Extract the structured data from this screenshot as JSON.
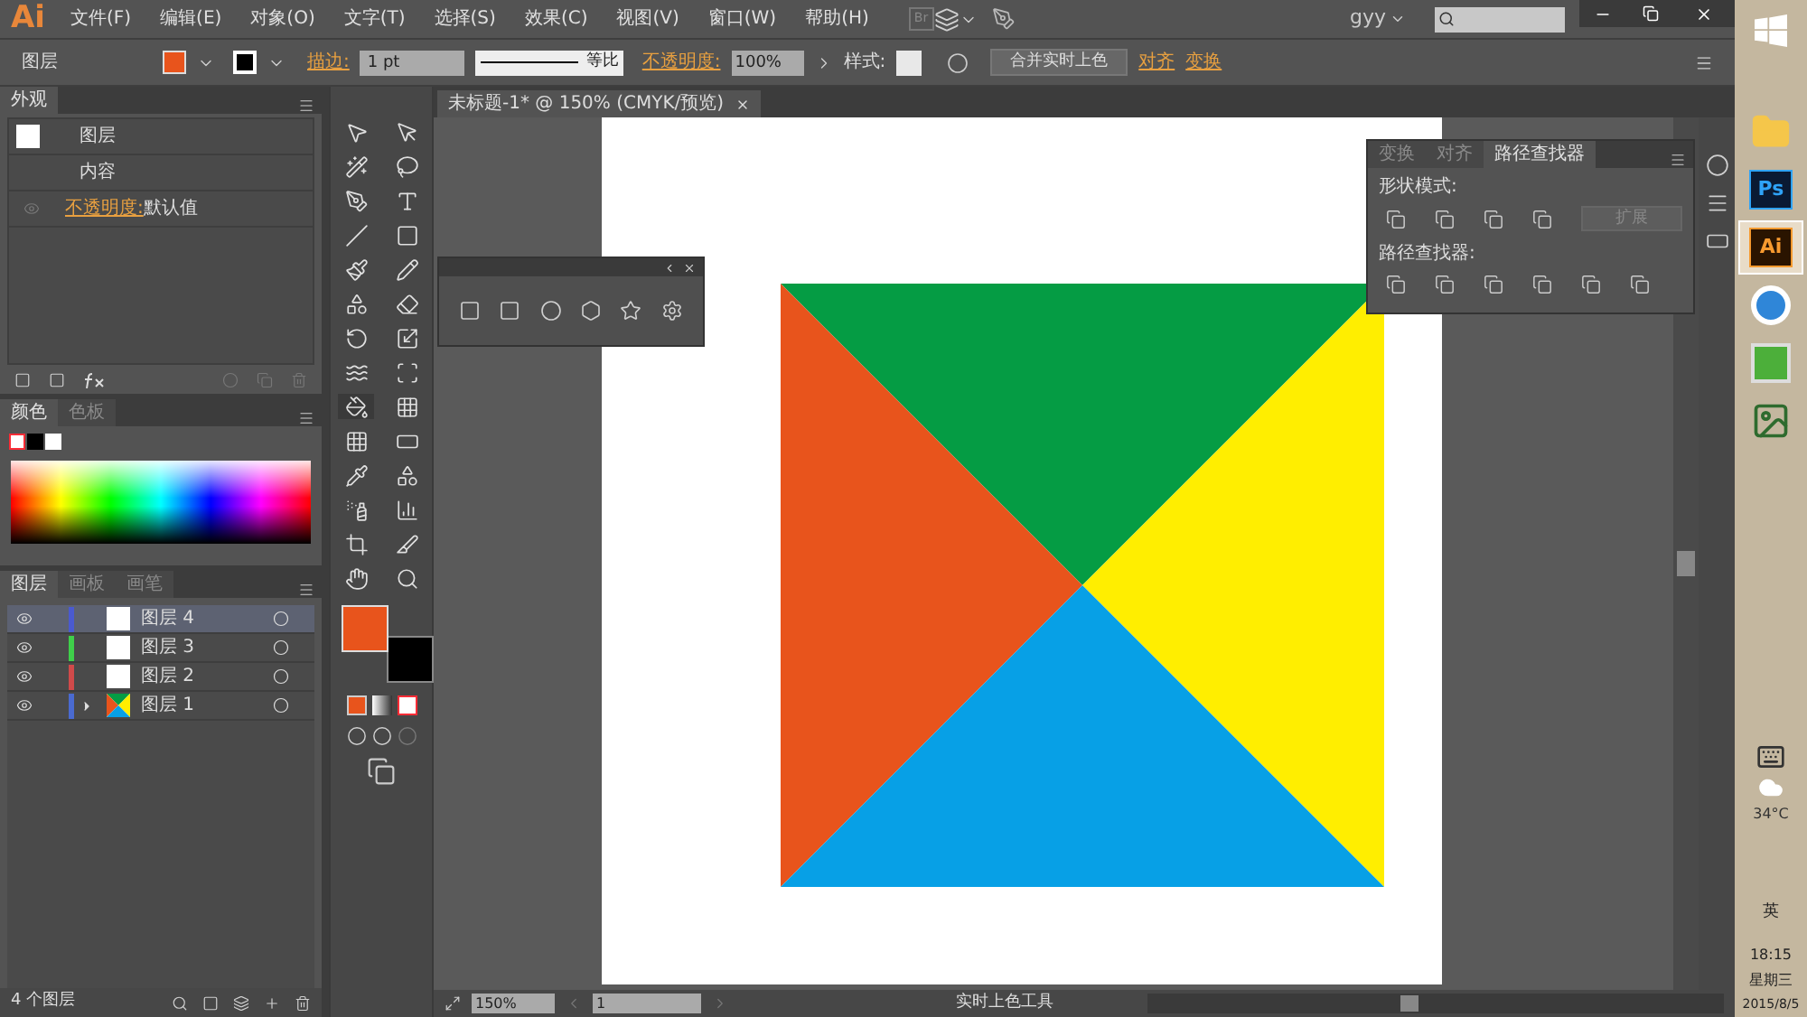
{
  "app": {
    "logo": "Ai",
    "menu": [
      "文件(F)",
      "编辑(E)",
      "对象(O)",
      "文字(T)",
      "选择(S)",
      "效果(C)",
      "视图(V)",
      "窗口(W)",
      "帮助(H)"
    ],
    "bridge": "Br",
    "user": "gyy"
  },
  "control_bar": {
    "selection": "图层",
    "stroke_label": "描边:",
    "stroke_weight": "1 pt",
    "profile": "等比",
    "opacity_label": "不透明度:",
    "opacity": "100%",
    "style_label": "样式:",
    "merge_button": "合并实时上色",
    "align_link": "对齐",
    "transform_link": "变换"
  },
  "appearance_panel": {
    "tab": "外观",
    "title_row": "图层",
    "content_row": "内容",
    "opacity_link": "不透明度:",
    "opacity_value": "默认值"
  },
  "color_panel": {
    "tabs": [
      {
        "label": "颜色",
        "selected": true
      },
      {
        "label": "色板",
        "selected": false
      }
    ]
  },
  "layers_panel": {
    "tabs": [
      {
        "label": "图层",
        "selected": true
      },
      {
        "label": "画板",
        "selected": false
      },
      {
        "label": "画笔",
        "selected": false
      }
    ],
    "layers": [
      {
        "name": "图层 4",
        "color": "#4a5ad0",
        "selected": true,
        "expandable": false
      },
      {
        "name": "图层 3",
        "color": "#3fcf4a",
        "selected": false,
        "expandable": false
      },
      {
        "name": "图层 2",
        "color": "#d04a4a",
        "selected": false,
        "expandable": false
      },
      {
        "name": "图层 1",
        "color": "#4a6ad0",
        "selected": false,
        "expandable": true
      }
    ],
    "footer": "4 个图层"
  },
  "document": {
    "tab_title": "未标题-1* @ 150% (CMYK/预览)"
  },
  "pathfinder_panel": {
    "tabs": [
      {
        "label": "变换",
        "selected": false
      },
      {
        "label": "对齐",
        "selected": false
      },
      {
        "label": "路径查找器",
        "selected": true
      }
    ],
    "shape_modes_label": "形状模式:",
    "expand_button": "扩展",
    "pathfinders_label": "路径查找器:"
  },
  "status_bar": {
    "zoom": "150%",
    "artboard": "1",
    "tool": "实时上色工具"
  },
  "taskbar": {
    "apps": [
      {
        "kind": "folder"
      },
      {
        "kind": "ps",
        "label": "Ps"
      },
      {
        "kind": "ai",
        "label": "Ai",
        "selected": true
      },
      {
        "kind": "sogou"
      },
      {
        "kind": "green"
      },
      {
        "kind": "photo"
      }
    ],
    "weather": "34°C",
    "ime": "英",
    "time": "18:15",
    "weekday": "星期三",
    "date": "2015/8/5"
  }
}
